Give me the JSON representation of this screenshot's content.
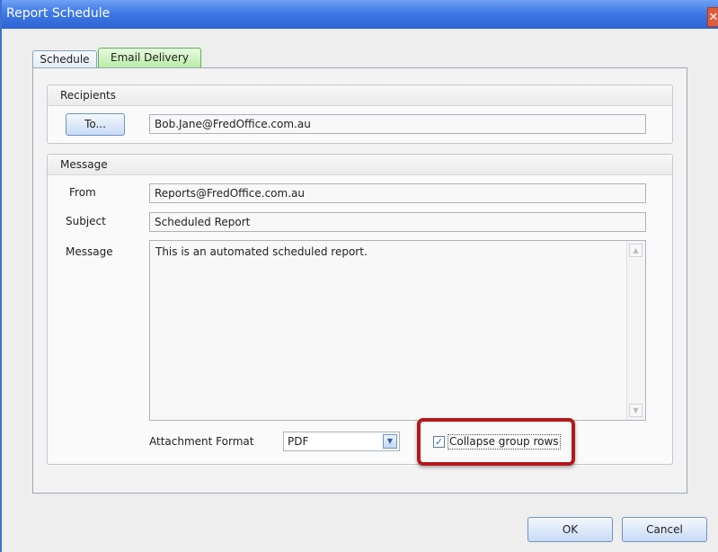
{
  "window": {
    "title": "Report Schedule",
    "close_glyph": "✕"
  },
  "tabs": [
    {
      "label": "Schedule",
      "active": false
    },
    {
      "label": "Email Delivery",
      "active": true
    }
  ],
  "recipients": {
    "header": "Recipients",
    "to_button": "To...",
    "to_value": "Bob.Jane@FredOffice.com.au"
  },
  "message": {
    "header": "Message",
    "from_label": "From",
    "from_value": "Reports@FredOffice.com.au",
    "subject_label": "Subject",
    "subject_value": "Scheduled Report",
    "message_label": "Message",
    "message_value": "This is an automated scheduled report.",
    "attachment_label": "Attachment Format",
    "attachment_value": "PDF",
    "collapse_label": "Collapse group rows",
    "collapse_checked": true
  },
  "buttons": {
    "ok": "OK",
    "cancel": "Cancel"
  },
  "colors": {
    "titlebar": "#3f79e6",
    "highlight": "#b3191c",
    "active_tab": "#b8eca5"
  }
}
